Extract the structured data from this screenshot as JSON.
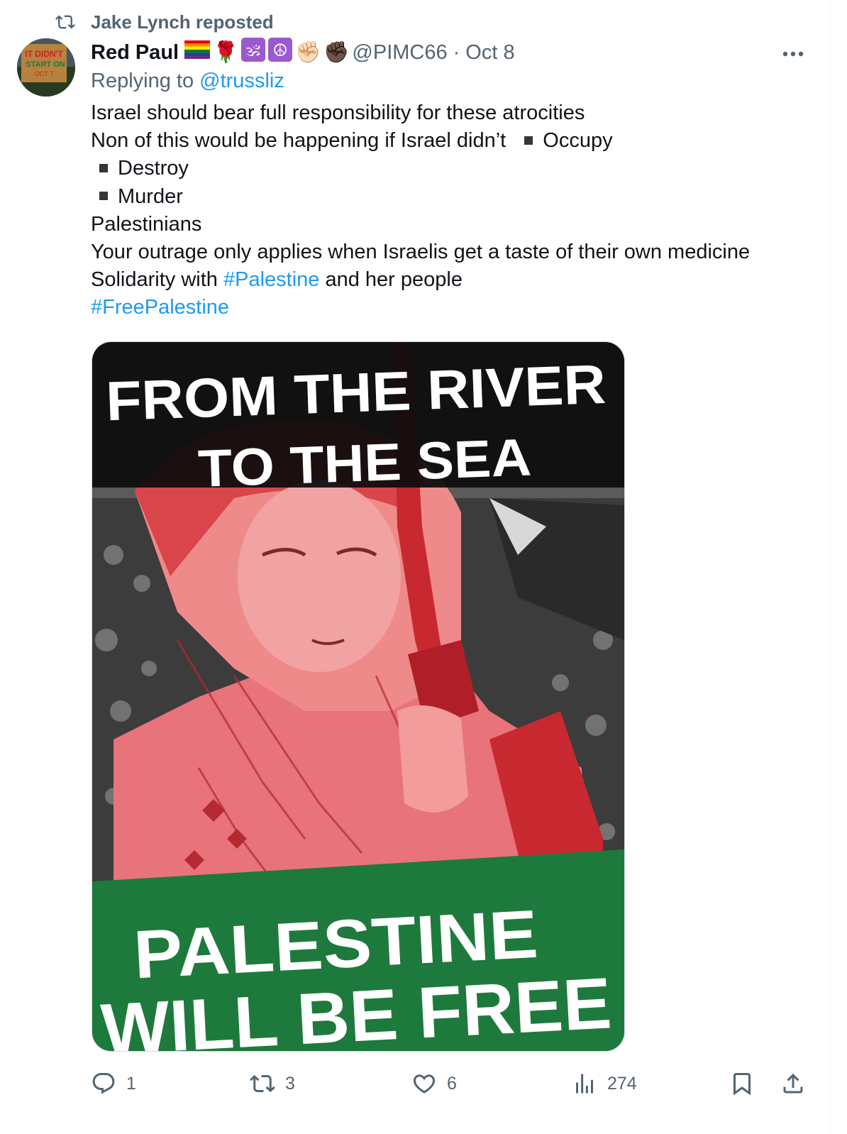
{
  "repost": {
    "text": "Jake Lynch reposted"
  },
  "author": {
    "display_name": "Red Paul",
    "emojis": [
      "🌹",
      "🕉",
      "☮",
      "✊🏻",
      "✊🏿"
    ],
    "handle": "@PIMC66",
    "separator": "·",
    "date": "Oct 8"
  },
  "avatar": {
    "sign_text": [
      "IT DIDN'T",
      "START ON",
      "OCT 7"
    ]
  },
  "reply": {
    "prefix": "Replying to",
    "to": "@trussliz"
  },
  "body": {
    "line1": "Israel should bear full responsibility for these atrocities",
    "line2": "Non of this would be happening if Israel didn’t",
    "list_item_1": "Occupy",
    "list_item_2": "Destroy",
    "list_item_3": "Murder",
    "line3": "Palestinians",
    "line4": "Your outrage only applies when Israelis get a taste of their own medicine",
    "line5_prefix": "Solidarity with",
    "line5_hashtag": "#Palestine",
    "line5_suffix": "and her people",
    "line6_hashtag": "#FreePalestine"
  },
  "media": {
    "top_text_1": "FROM THE RIVER",
    "top_text_2": "TO THE SEA",
    "bottom_text_1": "PALESTINE",
    "bottom_text_2": "WILL BE FREE",
    "colors": {
      "banner_top": "#0b0b0b",
      "banner_bottom": "#1e7a3c",
      "tint": "#e0403f"
    }
  },
  "actions": {
    "replies": "1",
    "reposts": "3",
    "likes": "6",
    "views": "274",
    "icons": [
      "reply-icon",
      "repost-icon",
      "like-icon",
      "views-icon",
      "bookmark-icon",
      "share-icon"
    ]
  }
}
